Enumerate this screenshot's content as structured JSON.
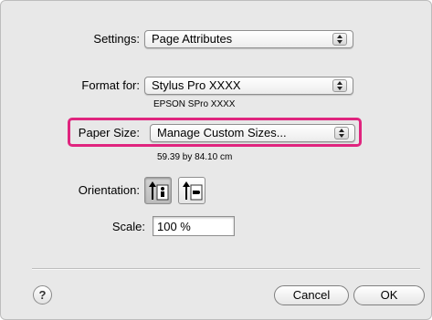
{
  "settings": {
    "label": "Settings:",
    "value": "Page Attributes"
  },
  "format_for": {
    "label": "Format for:",
    "value": "Stylus Pro XXXX",
    "subtitle": "EPSON SPro XXXX"
  },
  "paper_size": {
    "label": "Paper Size:",
    "value": "Manage Custom Sizes...",
    "dimensions": "59.39 by 84.10 cm"
  },
  "orientation": {
    "label": "Orientation:",
    "options": [
      {
        "name": "portrait",
        "selected": true
      },
      {
        "name": "landscape",
        "selected": false
      }
    ]
  },
  "scale": {
    "label": "Scale:",
    "value": "100 %"
  },
  "buttons": {
    "help": "?",
    "cancel": "Cancel",
    "ok": "OK"
  },
  "colors": {
    "highlight": "#e0247e",
    "dialog_bg": "#e8e8e8"
  }
}
